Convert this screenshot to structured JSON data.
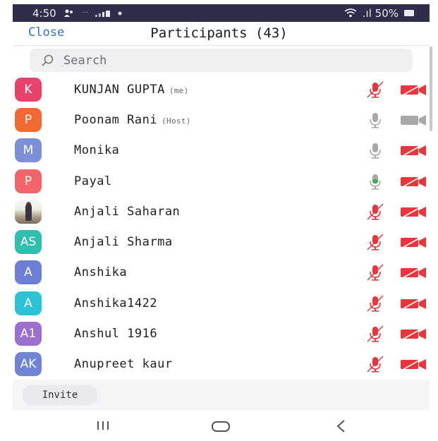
{
  "status_bar": {
    "time": "4:50",
    "notice_icons": "···",
    "signal_text": ".ıl 50%"
  },
  "header": {
    "close_label": "Close",
    "title": "Participants (43)"
  },
  "search": {
    "placeholder": "Search"
  },
  "colors": {
    "accent_blue": "#2c74ce",
    "muted_red": "#e8363c",
    "gray_icon": "#a8a8a8",
    "talking_green": "#3bb44a"
  },
  "participants": [
    {
      "initials": "K",
      "name": "KUNJAN GUPTA",
      "tag": "(me)",
      "avatar_color": "#e8436a",
      "mic": "muted",
      "video": "off"
    },
    {
      "initials": "P",
      "name": "Poonam Rani",
      "tag": "(Host)",
      "avatar_color": "#f06a32",
      "mic": "on",
      "video": "on"
    },
    {
      "initials": "M",
      "name": "Monika",
      "tag": "",
      "avatar_color": "#7d8fd6",
      "mic": "on",
      "video": "off"
    },
    {
      "initials": "P",
      "name": "Payal",
      "tag": "",
      "avatar_color": "#f0646a",
      "mic": "talking",
      "video": "off"
    },
    {
      "initials": "",
      "name": "Anjali Saharan",
      "tag": "",
      "avatar_color": "photo",
      "mic": "muted",
      "video": "off"
    },
    {
      "initials": "AS",
      "name": "Anjali Sharma",
      "tag": "",
      "avatar_color": "#2fbfb0",
      "mic": "muted",
      "video": "off"
    },
    {
      "initials": "A",
      "name": "Anshika",
      "tag": "",
      "avatar_color": "#6d7fd4",
      "mic": "muted",
      "video": "off"
    },
    {
      "initials": "A",
      "name": "Anshika1422",
      "tag": "",
      "avatar_color": "#2cc3d6",
      "mic": "muted",
      "video": "off"
    },
    {
      "initials": "A1",
      "name": "Anshul 1916",
      "tag": "",
      "avatar_color": "#9b6fd0",
      "mic": "muted",
      "video": "off"
    },
    {
      "initials": "AK",
      "name": "Anupreet kaur",
      "tag": "",
      "avatar_color": "#6f84d6",
      "mic": "muted",
      "video": "off"
    }
  ],
  "footer": {
    "invite_label": "Invite"
  },
  "navbar": {
    "recents_icon": "recents-icon",
    "home_icon": "home-icon",
    "back_icon": "back-icon"
  }
}
